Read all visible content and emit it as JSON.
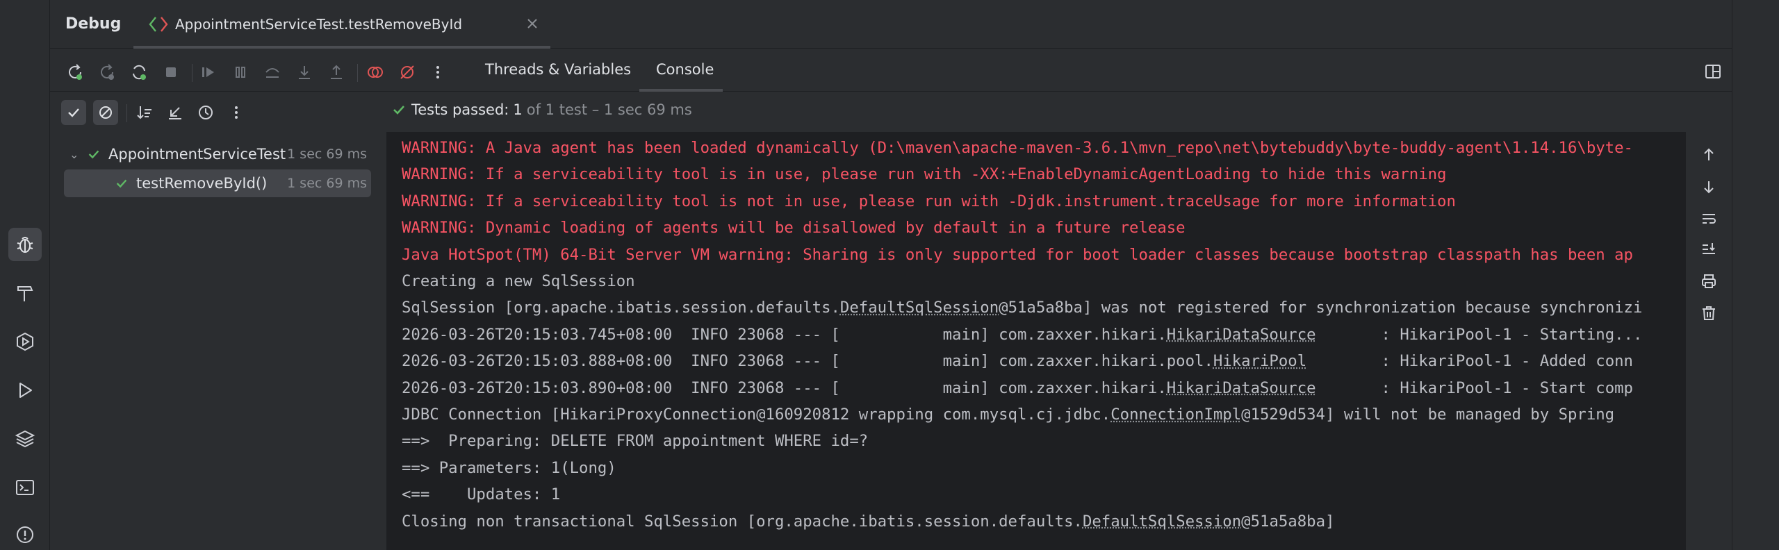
{
  "panel": {
    "title": "Debug",
    "session_tab": "AppointmentServiceTest.testRemoveById"
  },
  "toolbar": {
    "tabs": [
      "Threads & Variables",
      "Console"
    ],
    "active_tab": "Console"
  },
  "test_status": {
    "passed_label": "Tests passed:",
    "passed_count": "1",
    "rest": "of 1 test – 1 sec 69 ms"
  },
  "tree": {
    "root": {
      "label": "AppointmentServiceTest",
      "duration": "1 sec 69 ms"
    },
    "child": {
      "label": "testRemoveById()",
      "duration": "1 sec 69 ms"
    }
  },
  "console": {
    "lines": [
      {
        "kind": "warn",
        "text": "WARNING: A Java agent has been loaded dynamically (D:\\maven\\apache-maven-3.6.1\\mvn_repo\\net\\bytebuddy\\byte-buddy-agent\\1.14.16\\byte-"
      },
      {
        "kind": "warn",
        "text": "WARNING: If a serviceability tool is in use, please run with -XX:+EnableDynamicAgentLoading to hide this warning"
      },
      {
        "kind": "warn",
        "text": "WARNING: If a serviceability tool is not in use, please run with -Djdk.instrument.traceUsage for more information"
      },
      {
        "kind": "warn",
        "text": "WARNING: Dynamic loading of agents will be disallowed by default in a future release"
      },
      {
        "kind": "warn",
        "text": "Java HotSpot(TM) 64-Bit Server VM warning: Sharing is only supported for boot loader classes because bootstrap classpath has been ap"
      },
      {
        "kind": "info",
        "text": "Creating a new SqlSession"
      },
      {
        "kind": "info",
        "pre": "SqlSession [org.apache.ibatis.session.defaults.",
        "link": "DefaultSqlSession",
        "post": "@51a5a8ba] was not registered for synchronization because synchronizi"
      },
      {
        "kind": "info",
        "pre": "2026-03-26T20:15:03.745+08:00  INFO 23068 --- [           main] com.zaxxer.hikari.",
        "link": "HikariDataSource",
        "post": "       : HikariPool-1 - Starting..."
      },
      {
        "kind": "info",
        "pre": "2026-03-26T20:15:03.888+08:00  INFO 23068 --- [           main] com.zaxxer.hikari.pool.",
        "link": "HikariPool",
        "post": "        : HikariPool-1 - Added conn"
      },
      {
        "kind": "info",
        "pre": "2026-03-26T20:15:03.890+08:00  INFO 23068 --- [           main] com.zaxxer.hikari.",
        "link": "HikariDataSource",
        "post": "       : HikariPool-1 - Start comp"
      },
      {
        "kind": "info",
        "pre": "JDBC Connection [HikariProxyConnection@160920812 wrapping com.mysql.cj.jdbc.",
        "link": "ConnectionImpl",
        "post": "@1529d534] will not be managed by Spring"
      },
      {
        "kind": "info",
        "text": "==>  Preparing: DELETE FROM appointment WHERE id=?"
      },
      {
        "kind": "info",
        "text": "==> Parameters: 1(Long)"
      },
      {
        "kind": "info",
        "text": "<==    Updates: 1"
      },
      {
        "kind": "info",
        "pre": "Closing non transactional SqlSession [org.apache.ibatis.session.defaults.",
        "link": "DefaultSqlSession",
        "post": "@51a5a8ba]"
      }
    ]
  },
  "colors": {
    "accent_green": "#5fb865",
    "warning_red": "#f75464",
    "icon_gray": "#9a9da2",
    "icon_dim": "#6f737a",
    "stop_red": "#e05555"
  },
  "icons": {
    "left_strip": [
      "bug-icon",
      "hammer-icon",
      "services-icon",
      "run-icon",
      "layers-icon",
      "terminal-icon",
      "problems-icon"
    ],
    "toolbar": [
      "rerun-icon",
      "rerun-failed-icon",
      "rerun-session-icon",
      "stop-icon",
      "resume-icon",
      "pause-icon",
      "step-over-icon",
      "step-into-icon",
      "step-out-icon",
      "view-breakpoints-icon",
      "mute-breakpoints-icon",
      "more-icon"
    ],
    "test_toolbar": [
      "show-passed-icon",
      "show-ignored-icon",
      "sort-icon",
      "collapse-icon",
      "history-icon",
      "more-icon"
    ],
    "console_side": [
      "scroll-up-icon",
      "scroll-down-icon",
      "soft-wrap-icon",
      "scroll-to-end-icon",
      "print-icon",
      "clear-icon"
    ]
  }
}
